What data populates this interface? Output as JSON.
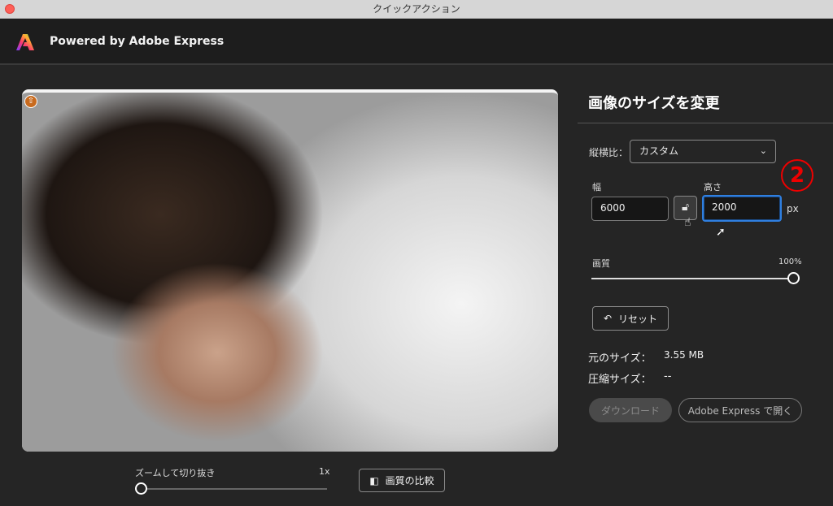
{
  "window": {
    "title": "クイックアクション"
  },
  "header": {
    "brand": "Powered by Adobe Express"
  },
  "preview": {
    "zoom_label": "ズームして切り抜き",
    "zoom_value": "1x",
    "zoom_fraction": 0,
    "compare_label": "画質の比較"
  },
  "panel": {
    "title": "画像のサイズを変更",
    "aspect_label": "縦横比：",
    "aspect_value": "カスタム",
    "width_label": "幅",
    "width_value": "6000",
    "height_label": "高さ",
    "height_value": "2000",
    "unit": "px",
    "annotation": "2",
    "quality_label": "画質",
    "quality_value": "100%",
    "quality_fraction": 1.0,
    "reset_label": "リセット",
    "original_size_label": "元のサイズ：",
    "original_size_value": "3.55 MB",
    "compressed_size_label": "圧縮サイズ：",
    "compressed_size_value": "--",
    "download_label": "ダウンロード",
    "open_label": "Adobe Express で開く"
  }
}
